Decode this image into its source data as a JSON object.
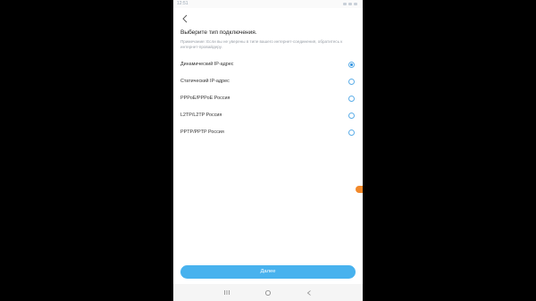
{
  "status_bar": {
    "time": "12:51"
  },
  "header": {
    "back_icon": "chevron-left-icon",
    "title": "Выберите тип подключения."
  },
  "hint": "Примечание: Если вы не уверены в типе вашего интернет-соединения, обратитесь к интернет-провайдеру.",
  "options": [
    {
      "label": "Динамический IP-адрес",
      "selected": true
    },
    {
      "label": "Статический IP-адрес",
      "selected": false
    },
    {
      "label": "PPPoE/PPPoE Россия",
      "selected": false
    },
    {
      "label": "L2TP/L2TP Россия",
      "selected": false
    },
    {
      "label": "PPTP/PPTP Россия",
      "selected": false
    }
  ],
  "next_button": {
    "label": "Далее"
  },
  "nav_bar": {
    "icons": [
      "recent-apps-icon",
      "home-icon",
      "back-icon"
    ]
  },
  "colors": {
    "accent": "#48b2ee",
    "radio_selected": "#2a8fe0",
    "floating_dot": "#f2892a"
  }
}
